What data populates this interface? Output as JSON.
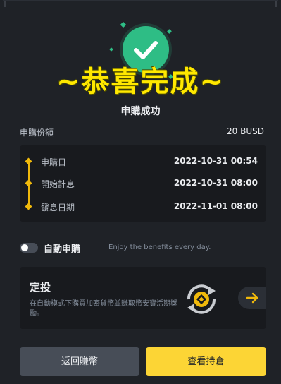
{
  "celebrate_text": "~恭喜完成~",
  "success_text": "申購成功",
  "amount": {
    "label": "申購份額",
    "value": "20 BUSD"
  },
  "timeline": [
    {
      "label": "申購日",
      "value": "2022-10-31 00:54"
    },
    {
      "label": "開始計息",
      "value": "2022-10-31 08:00"
    },
    {
      "label": "發息日期",
      "value": "2022-11-01 08:00"
    }
  ],
  "auto_subscribe": {
    "label": "自動申購",
    "description": "Enjoy the benefits every day.",
    "enabled": false
  },
  "promo": {
    "title": "定投",
    "description": "在自動模式下購買加密貨幣並賺取幣安寶活期獎勵。"
  },
  "buttons": {
    "back": "返回賺幣",
    "view": "查看持倉"
  },
  "colors": {
    "accent": "#fcd535",
    "success": "#2ebd85",
    "timeline": "#f0b90b",
    "celebrate": "#ffe800"
  }
}
